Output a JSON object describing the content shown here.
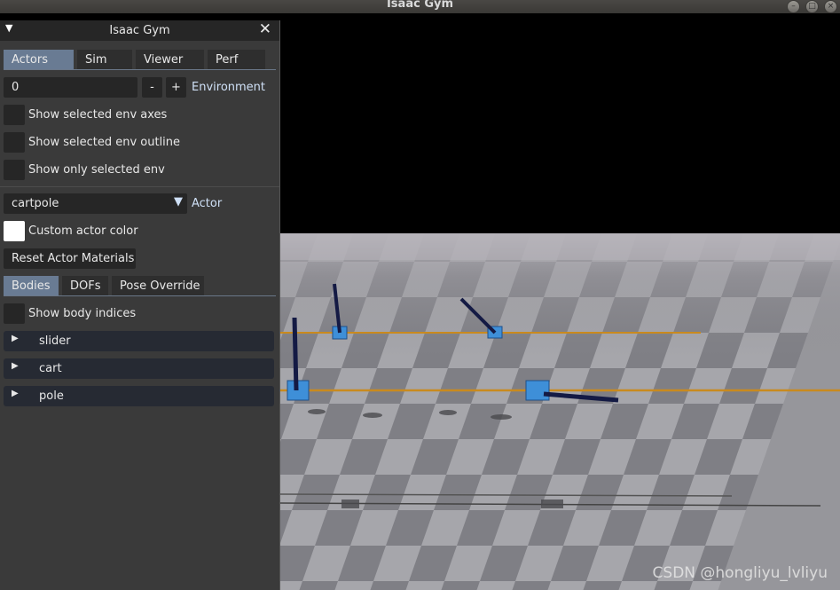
{
  "window": {
    "title": "Isaac Gym"
  },
  "panel": {
    "title": "Isaac Gym",
    "tabs": [
      {
        "label": "Actors",
        "active": true
      },
      {
        "label": "Sim",
        "active": false
      },
      {
        "label": "Viewer",
        "active": false
      },
      {
        "label": "Perf",
        "active": false
      }
    ],
    "env": {
      "value": "0",
      "minus": "-",
      "plus": "+",
      "label": "Environment"
    },
    "env_options": [
      {
        "label": "Show selected env axes",
        "checked": false
      },
      {
        "label": "Show selected env outline",
        "checked": false
      },
      {
        "label": "Show only selected env",
        "checked": false
      }
    ],
    "actor": {
      "selected": "cartpole",
      "label": "Actor"
    },
    "custom_color": {
      "label": "Custom actor color",
      "checked": true
    },
    "reset_button": "Reset Actor Materials",
    "subtabs": [
      {
        "label": "Bodies",
        "active": true
      },
      {
        "label": "DOFs",
        "active": false
      },
      {
        "label": "Pose Override",
        "active": false
      }
    ],
    "show_body_indices": {
      "label": "Show body indices",
      "checked": false
    },
    "bodies": [
      {
        "label": "slider"
      },
      {
        "label": "cart"
      },
      {
        "label": "pole"
      }
    ]
  },
  "watermark": "CSDN @hongliyu_lvliyu"
}
